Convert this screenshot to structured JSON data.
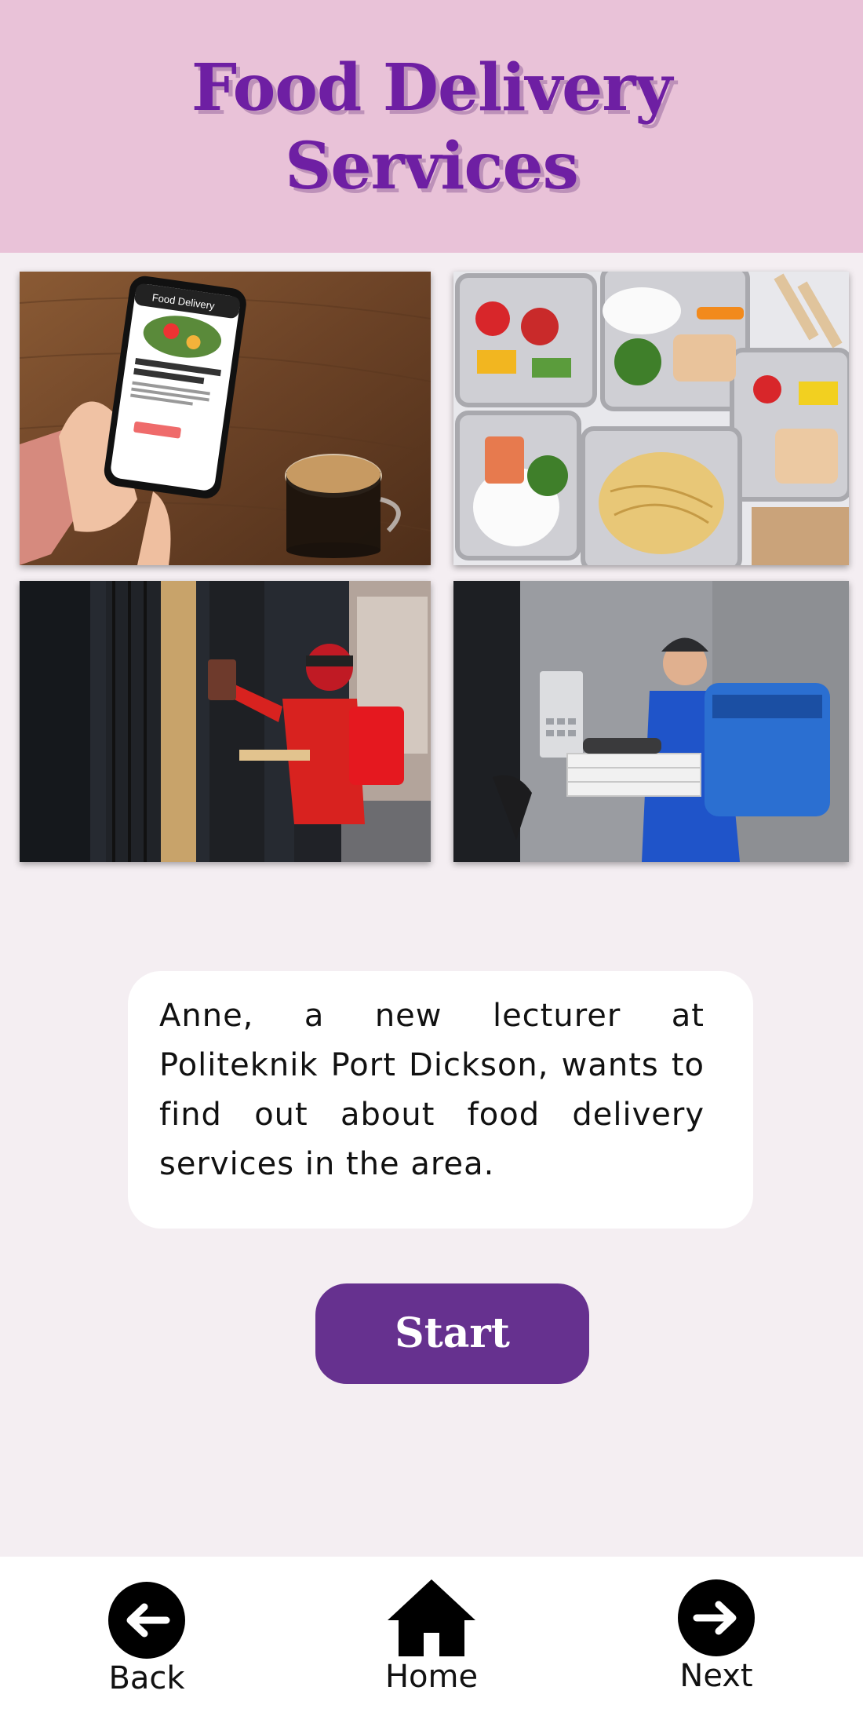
{
  "header": {
    "title_line1": "Food Delivery",
    "title_line2": "Services"
  },
  "images": [
    {
      "name": "phone-food-app-photo"
    },
    {
      "name": "meal-containers-photo"
    },
    {
      "name": "courier-at-door-photo"
    },
    {
      "name": "courier-with-pizzas-photo"
    }
  ],
  "phone_app": {
    "app_name": "Food Delivery",
    "product": "Nutrient-rich Buckwheat Bowl & Sauce",
    "price": "$7.49",
    "cta": "ADD TO CART"
  },
  "intro": {
    "text": "Anne, a new lecturer at Politeknik Port Dickson, wants to find out about food delivery services in the area."
  },
  "start_button": {
    "label": "Start"
  },
  "nav": {
    "back": "Back",
    "home": "Home",
    "next": "Next"
  },
  "colors": {
    "header_bg": "#e9c2d8",
    "title": "#6e1fa3",
    "button": "#66318f",
    "page_bg": "#f4eef2"
  }
}
